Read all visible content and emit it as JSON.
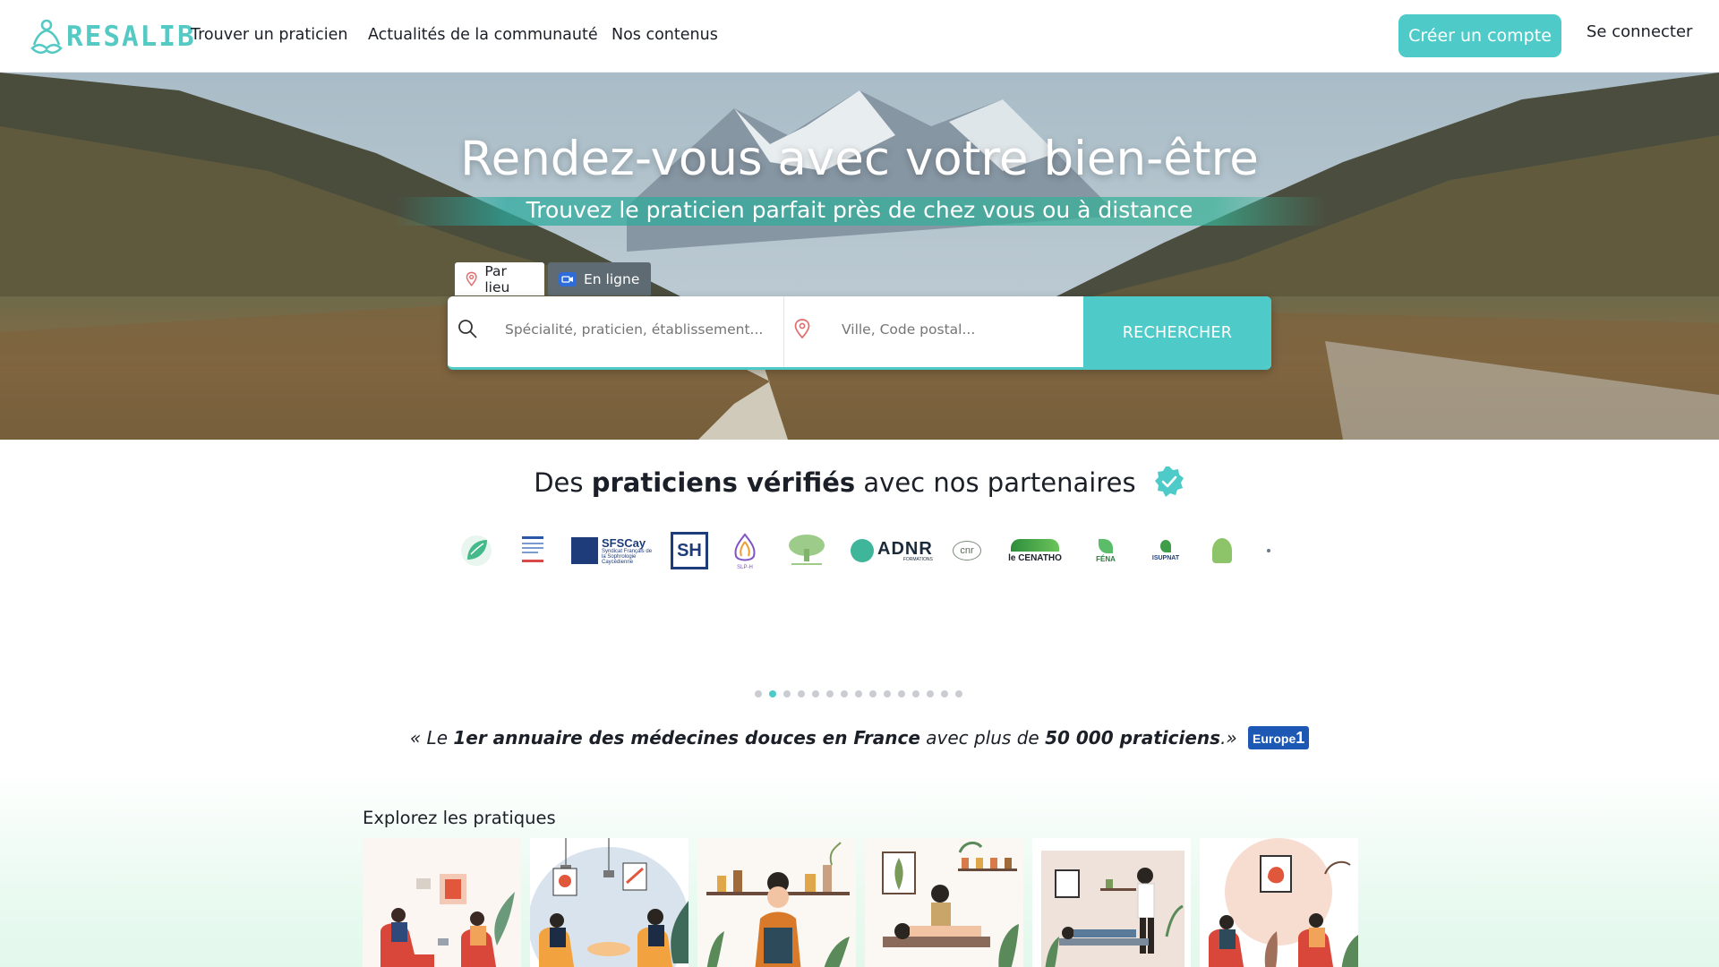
{
  "brand": {
    "name": "RESALIB",
    "accent": "#4ecbc9"
  },
  "nav": {
    "links": [
      "Trouver un praticien",
      "Actualités de la communauté",
      "Nos contenus"
    ],
    "create_account": "Créer un compte",
    "login": "Se connecter"
  },
  "hero": {
    "title": "Rendez-vous avec votre bien-être",
    "subtitle": "Trouvez le praticien parfait près de chez vous ou à distance",
    "tabs": [
      {
        "label": "Par lieu",
        "icon": "map-pin-icon",
        "active": true
      },
      {
        "label": "En ligne",
        "icon": "video-icon",
        "active": false
      }
    ],
    "search": {
      "query_placeholder": "Spécialité, praticien, établissement...",
      "location_placeholder": "Ville, Code postal...",
      "button": "RECHERCHER"
    }
  },
  "partners": {
    "title_pre": "Des ",
    "title_bold": "praticiens vérifiés",
    "title_post": " avec nos partenaires",
    "logos": [
      "SFSCay",
      "SH",
      "SLP-H",
      "ADNR",
      "CNR",
      "le CENATHO",
      "FENA",
      "ISUPNAT"
    ],
    "logo_texts": {
      "sfscay": "SFSCay",
      "sfscay_sub": "Syndicat Français de la Sophrologie Caycédienne",
      "sh": "SH",
      "slph": "SLP-H",
      "adnr": "ADNR",
      "adnr_sub": "FORMATIONS",
      "cnr": "cnr",
      "cenatho": "le CENATHO",
      "fena": "FÉNA",
      "isupnat": "ISUPNAT"
    },
    "carousel_pages": 15,
    "active_page": 2
  },
  "quote": {
    "open": "« Le ",
    "bold1": "1er annuaire des médecines douces en France",
    "mid": " avec plus de ",
    "bold2": "50 000 praticiens",
    "close": ".»",
    "source": "Europe 1"
  },
  "explore": {
    "title": "Explorez les pratiques",
    "cards": [
      "card-1",
      "card-2",
      "card-3",
      "card-4",
      "card-5",
      "card-6"
    ]
  }
}
